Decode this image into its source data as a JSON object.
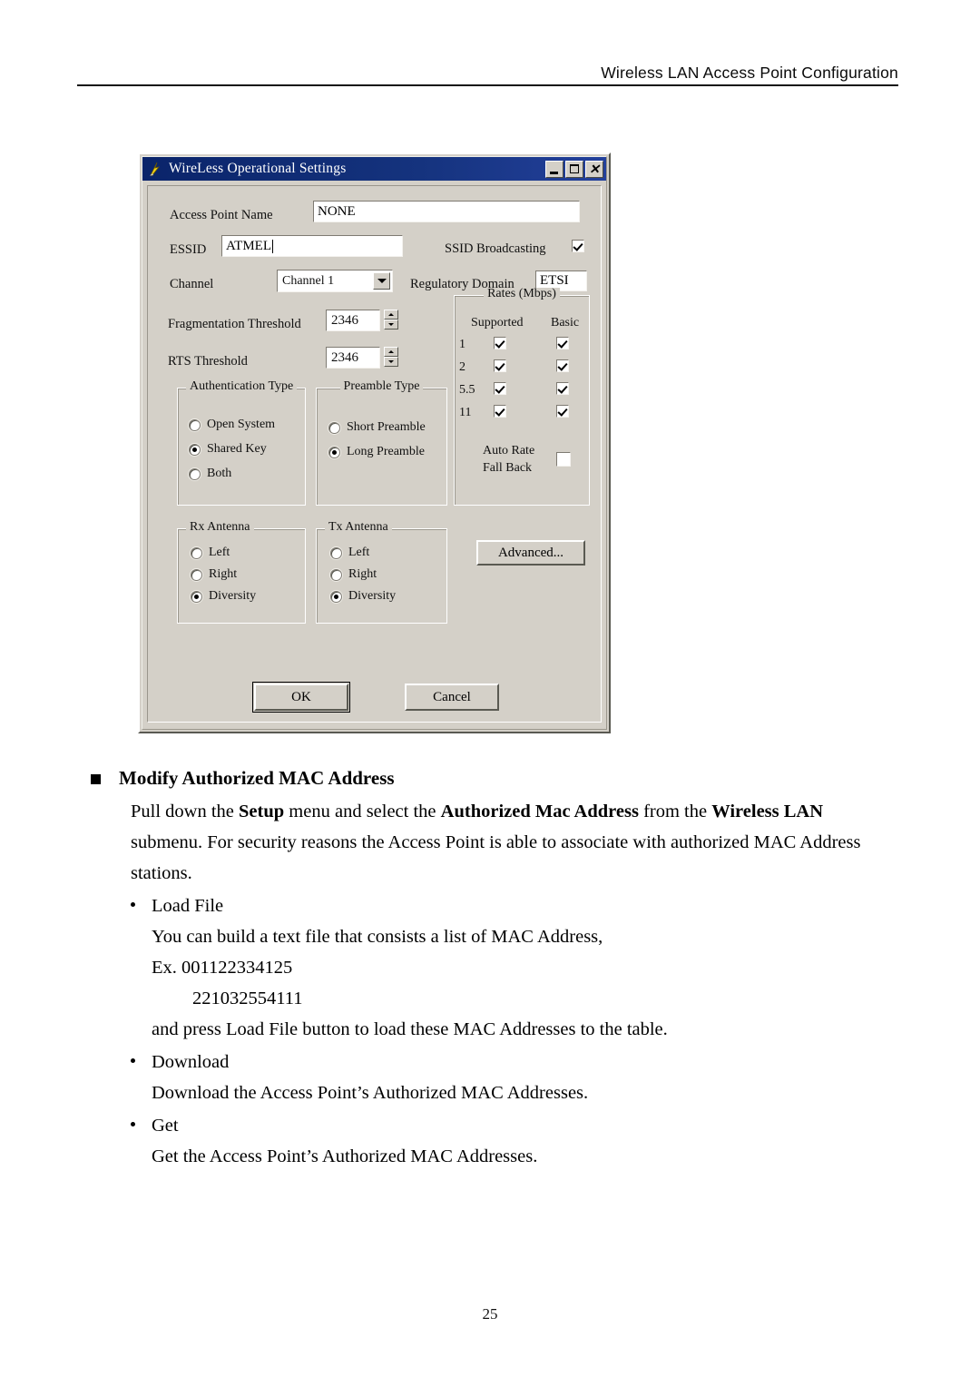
{
  "header": {
    "running_title": "Wireless LAN Access Point Configuration"
  },
  "dialog": {
    "title": "WireLess Operational Settings",
    "title_icon": "lightning-bolt-icon",
    "window_controls": {
      "minimize": "_",
      "maximize": "□",
      "close": "✕"
    },
    "access_point_name": {
      "label": "Access Point Name",
      "value": "NONE"
    },
    "essid": {
      "label": "ESSID",
      "value": "ATMEL"
    },
    "ssid_broadcasting": {
      "label": "SSID Broadcasting",
      "checked": true
    },
    "channel": {
      "label": "Channel",
      "value": "Channel 1"
    },
    "regulatory_domain": {
      "label": "Regulatory Domain",
      "value": "ETSI"
    },
    "fragmentation_threshold": {
      "label": "Fragmentation Threshold",
      "value": "2346"
    },
    "rts_threshold": {
      "label": "RTS Threshold",
      "value": "2346"
    },
    "authentication_type": {
      "legend": "Authentication Type",
      "options": [
        {
          "label": "Open System",
          "selected": false
        },
        {
          "label": "Shared Key",
          "selected": true
        },
        {
          "label": "Both",
          "selected": false
        }
      ]
    },
    "preamble_type": {
      "legend": "Preamble Type",
      "options": [
        {
          "label": "Short Preamble",
          "selected": false
        },
        {
          "label": "Long Preamble",
          "selected": true
        }
      ]
    },
    "rates": {
      "legend": "Rates (Mbps)",
      "col_supported": "Supported",
      "col_basic": "Basic",
      "rows": [
        {
          "rate": "1",
          "supported": true,
          "basic": true
        },
        {
          "rate": "2",
          "supported": true,
          "basic": true
        },
        {
          "rate": "5.5",
          "supported": true,
          "basic": true
        },
        {
          "rate": "11",
          "supported": true,
          "basic": true
        }
      ],
      "auto_rate_fall_back": {
        "label_line1": "Auto Rate",
        "label_line2": "Fall Back",
        "checked": false
      }
    },
    "rx_antenna": {
      "legend": "Rx Antenna",
      "options": [
        {
          "label": "Left",
          "selected": false
        },
        {
          "label": "Right",
          "selected": false
        },
        {
          "label": "Diversity",
          "selected": true
        }
      ]
    },
    "tx_antenna": {
      "legend": "Tx Antenna",
      "options": [
        {
          "label": "Left",
          "selected": false
        },
        {
          "label": "Right",
          "selected": false
        },
        {
          "label": "Diversity",
          "selected": true
        }
      ]
    },
    "buttons": {
      "advanced": "Advanced...",
      "ok": "OK",
      "cancel": "Cancel"
    }
  },
  "content": {
    "section_heading": "Modify Authorized MAC Address",
    "intro_parts": {
      "p1": "Pull down the ",
      "b1": "Setup",
      "p2": " menu and select the ",
      "b2": "Authorized Mac Address",
      "p3": " from the ",
      "b3": "Wireless LAN",
      "p4": " submenu. For security reasons the Access Point is able to associate with authorized MAC Address stations."
    },
    "bullets": [
      {
        "title": "Load File",
        "lines": [
          "You can build a text file that consists a list of MAC Address,",
          "Ex. 001122334125",
          "221032554111",
          "and press Load File button to load these MAC Addresses to the table."
        ]
      },
      {
        "title": "Download",
        "lines": [
          "Download the Access Point’s Authorized MAC Addresses."
        ]
      },
      {
        "title": "Get",
        "lines": [
          "Get the Access Point’s Authorized MAC Addresses."
        ]
      }
    ]
  },
  "footer": {
    "page_number": "25"
  }
}
